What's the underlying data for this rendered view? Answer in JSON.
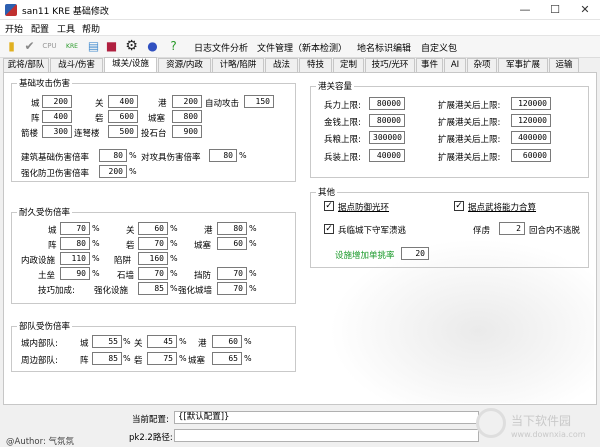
{
  "window": {
    "title": "san11 KRE 基础修改",
    "minimize": "—",
    "maximize": "☐",
    "close": "✕"
  },
  "menu": [
    "开始",
    "配置",
    "工具",
    "帮助"
  ],
  "toolbar": {
    "logs": "日志文件分析",
    "files": "文件管理（新本检测）",
    "placenames": "地名标识编辑",
    "custom": "自定义包"
  },
  "tabs": [
    "武将/部队",
    "战斗/伤害",
    "城关/设施",
    "资源/内政",
    "计略/陷阱",
    "战法",
    "特技",
    "定制",
    "技巧/光环",
    "事件",
    "AI",
    "杂项",
    "军事扩展",
    "运输"
  ],
  "base_attack": {
    "title": "基础攻击伤害",
    "rows": [
      [
        {
          "label": "城",
          "value": "200"
        },
        {
          "label": "关",
          "value": "400"
        },
        {
          "label": "港",
          "value": "200"
        },
        {
          "label": "自动攻击",
          "value": "150"
        }
      ],
      [
        {
          "label": "阵",
          "value": "400"
        },
        {
          "label": "砦",
          "value": "600"
        },
        {
          "label": "城塞",
          "value": "800"
        }
      ],
      [
        {
          "label": "箭楼",
          "value": "300"
        },
        {
          "label": "连弩楼",
          "value": "500"
        },
        {
          "label": "投石台",
          "value": "900"
        }
      ]
    ],
    "pct": [
      {
        "label": "建筑基础伤害倍率",
        "value": "80"
      },
      {
        "label": "对攻具伤害倍率",
        "value": "80"
      },
      {
        "label": "强化防卫伤害倍率",
        "value": "200"
      }
    ]
  },
  "durability": {
    "title": "耐久受伤倍率",
    "rows": [
      [
        {
          "label": "城",
          "value": "70"
        },
        {
          "label": "关",
          "value": "60"
        },
        {
          "label": "港",
          "value": "80"
        }
      ],
      [
        {
          "label": "阵",
          "value": "80"
        },
        {
          "label": "砦",
          "value": "70"
        },
        {
          "label": "城塞",
          "value": "60"
        }
      ],
      [
        {
          "label": "内政设施",
          "value": "110"
        },
        {
          "label": "陷阱",
          "value": "160"
        }
      ],
      [
        {
          "label": "土垒",
          "value": "90"
        },
        {
          "label": "石墙",
          "value": "70"
        },
        {
          "label": "挡防",
          "value": "70"
        }
      ],
      [
        {
          "label": "技巧加成:",
          "value": ""
        },
        {
          "label": "强化设施",
          "value": "85"
        },
        {
          "label": "强化城墙",
          "value": "70"
        }
      ]
    ]
  },
  "troop_damage": {
    "title": "部队受伤倍率",
    "rows": [
      [
        {
          "label": "城内部队:",
          "value": ""
        },
        {
          "label": "城",
          "value": "55"
        },
        {
          "label": "关",
          "value": "45"
        },
        {
          "label": "港",
          "value": "60"
        }
      ],
      [
        {
          "label": "周边部队:",
          "value": ""
        },
        {
          "label": "阵",
          "value": "85"
        },
        {
          "label": "砦",
          "value": "75"
        },
        {
          "label": "城塞",
          "value": "65"
        }
      ]
    ]
  },
  "capacity": {
    "title": "港关容量",
    "rows": [
      [
        {
          "label": "兵力上限:",
          "value": "80000"
        },
        {
          "label": "扩展港关后上限:",
          "value": "120000"
        }
      ],
      [
        {
          "label": "金钱上限:",
          "value": "80000"
        },
        {
          "label": "扩展港关后上限:",
          "value": "120000"
        }
      ],
      [
        {
          "label": "兵粮上限:",
          "value": "300000"
        },
        {
          "label": "扩展港关后上限:",
          "value": "400000"
        }
      ],
      [
        {
          "label": "兵装上限:",
          "value": "40000"
        },
        {
          "label": "扩展港关后上限:",
          "value": "60000"
        }
      ]
    ]
  },
  "other": {
    "title": "其他",
    "cb1": "据点防御光环",
    "cb2": "据点武将能力合算",
    "cb3": "兵临城下守军溃逃",
    "captive_label": "俘虏",
    "captive_value": "2",
    "captive_suffix": "回合内不逃脱",
    "trap_label": "设施增加单挑率",
    "trap_value": "20"
  },
  "units": {
    "pct": "%"
  },
  "status": {
    "config_label": "当前配置:",
    "config_value": "{[默认配置]}",
    "path_label": "pk2.2路径:",
    "path_value": "",
    "author": "@Author: 气氛氛"
  },
  "watermark": {
    "text": "当下软件园",
    "sub": "www.downxia.com"
  },
  "colors": {
    "accent_green": "#1a9a2a",
    "border": "#c9c9c9"
  }
}
